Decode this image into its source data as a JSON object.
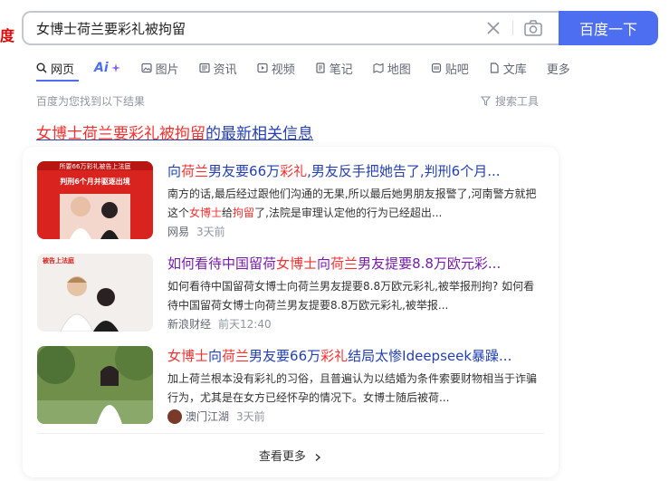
{
  "logo_fragment": "度",
  "search": {
    "query": "女博士荷兰要彩礼被拘留",
    "button_label": "百度一下"
  },
  "tabs": [
    {
      "label": "网页",
      "icon": "search-icon"
    },
    {
      "label": "Ai",
      "icon": "ai-sparkle-icon"
    },
    {
      "label": "图片",
      "icon": "image-icon"
    },
    {
      "label": "资讯",
      "icon": "news-icon"
    },
    {
      "label": "视频",
      "icon": "video-icon"
    },
    {
      "label": "笔记",
      "icon": "note-icon"
    },
    {
      "label": "地图",
      "icon": "map-icon"
    },
    {
      "label": "贴吧",
      "icon": "tieba-icon"
    },
    {
      "label": "文库",
      "icon": "doc-icon"
    },
    {
      "label": "更多",
      "icon": ""
    }
  ],
  "result_count": "百度为您找到以下结果",
  "tools_label": "搜索工具",
  "news_heading": {
    "query_part": "女博士荷兰要彩礼被拘留",
    "suffix": "的最新相关信息"
  },
  "results": [
    {
      "title": [
        "向",
        "荷兰",
        "男友要66万",
        "彩礼",
        ",男友反手把她告了,判刑6个月..."
      ],
      "snippet": [
        "南方的话,最后经过跟他们沟通的无果,所以最后她男朋友报警了,河南警方就把这个",
        "女博士",
        "给",
        "拘留",
        "了,法院是审理认定他的行为已经超出..."
      ],
      "source": "网易",
      "time": "3天前",
      "thumb_text_1": "所要66万彩礼被告上法庭",
      "thumb_text_2": "判刑6个月并驱逐出境"
    },
    {
      "title": [
        "如何看待中国留荷",
        "女博士",
        "向",
        "荷兰",
        "男友提要8.8万欧元彩..."
      ],
      "snippet": "如何看待中国留荷女博士向荷兰男友提要8.8万欧元彩礼,被举报刑拘? 如何看待中国留荷女博士向荷兰男友提要8.8万欧元彩礼,被举报...",
      "source": "新浪财经",
      "time": "前天12:40",
      "thumb_text_1": "被告上法庭"
    },
    {
      "title": [
        "女博士",
        "向",
        "荷兰",
        "男友要66万",
        "彩礼",
        "结局太惨Ideepseek暴躁..."
      ],
      "snippet": "加上荷兰根本没有彩礼的习俗，且普遍认为以结婚为条件索要财物相当于诈骗行为，尤其是在女方已经怀孕的情况下。女博士随后被荷...",
      "source": "澳门江湖",
      "time": "3天前"
    }
  ],
  "more_label": "查看更多",
  "colors": {
    "accent": "#4e6ef2",
    "highlight": "#f73131",
    "link": "#2440b3",
    "visited": "#771caa"
  }
}
